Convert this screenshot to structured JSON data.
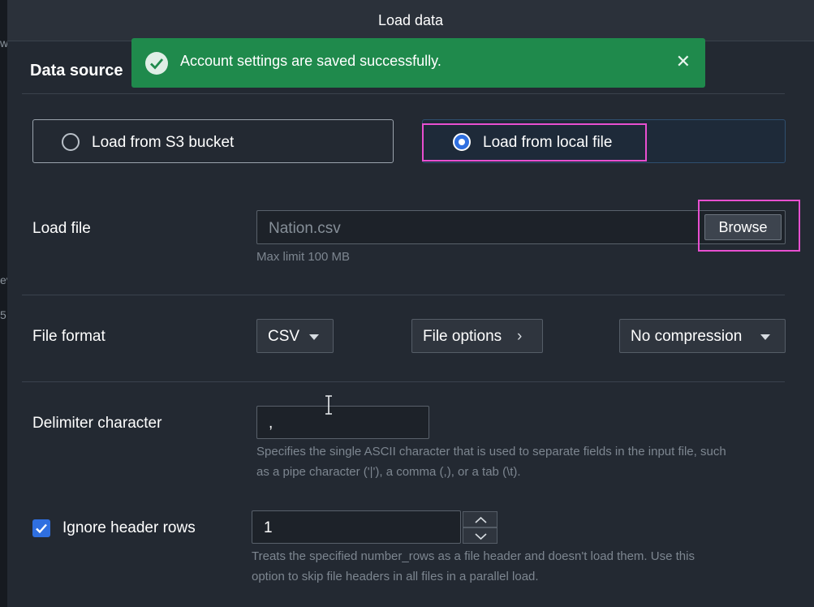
{
  "dialog": {
    "title": "Load data"
  },
  "section": {
    "title": "Data source"
  },
  "toast": {
    "message": "Account settings are saved successfully.",
    "close_label": "✕",
    "color": "#1f8a4c"
  },
  "source_options": [
    {
      "label": "Load from S3 bucket",
      "selected": false
    },
    {
      "label": "Load from local file",
      "selected": true
    }
  ],
  "load_file": {
    "label": "Load file",
    "value": "Nation.csv",
    "browse_label": "Browse",
    "hint": "Max limit 100 MB"
  },
  "file_format": {
    "label": "File format",
    "format_value": "CSV",
    "options_label": "File options",
    "compression_value": "No compression"
  },
  "delimiter": {
    "label": "Delimiter character",
    "value": ",",
    "hint_line1": "Specifies the single ASCII character that is used to separate fields in the input file, such",
    "hint_line2": "as a pipe character ('|'), a comma (,), or a tab (\\t)."
  },
  "ignore_header": {
    "label": "Ignore header rows",
    "checked": true,
    "value": "1",
    "hint_line1": "Treats the specified number_rows as a file header and doesn't load them. Use this",
    "hint_line2": "option to skip file headers in all files in a parallel load."
  },
  "backdrop": {
    "glyph_1": "w",
    "glyph_2": "ev",
    "glyph_3": "5"
  },
  "colors": {
    "accent": "#2f6fe0",
    "highlight": "#e84fd0"
  }
}
